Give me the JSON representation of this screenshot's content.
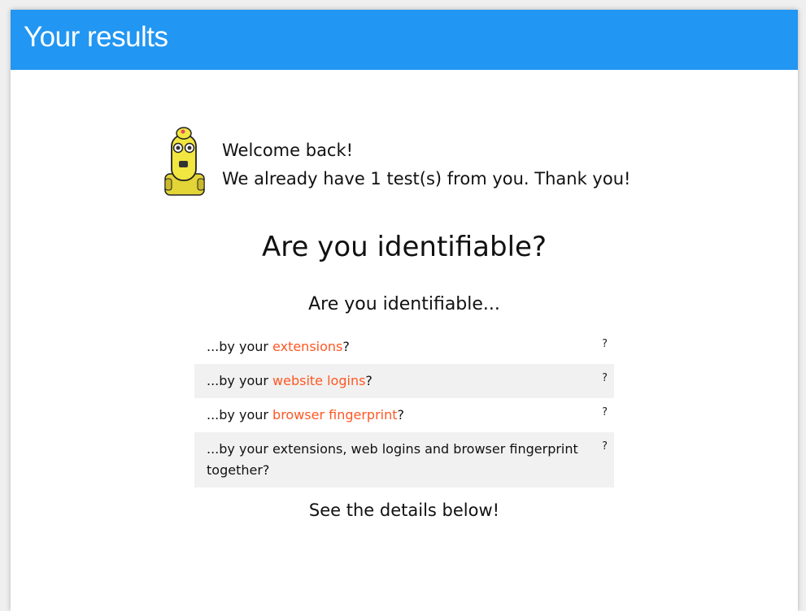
{
  "header": {
    "title": "Your results"
  },
  "welcome": {
    "greeting": "Welcome back!",
    "message": "We already have 1 test(s) from you. Thank you!"
  },
  "main": {
    "heading": "Are you identifiable?",
    "subheading": "Are you identifiable...",
    "checks": [
      {
        "prefix": "...by your ",
        "highlight": "extensions",
        "suffix": "?",
        "status": "?"
      },
      {
        "prefix": "...by your ",
        "highlight": "website logins",
        "suffix": "?",
        "status": "?"
      },
      {
        "prefix": "...by your ",
        "highlight": "browser fingerprint",
        "suffix": "?",
        "status": "?"
      },
      {
        "prefix": "...by your extensions, web logins and browser fingerprint together?",
        "highlight": "",
        "suffix": "",
        "status": "?"
      }
    ],
    "footer": "See the details below!"
  },
  "colors": {
    "header_bg": "#2196f3",
    "highlight": "#ff5722",
    "alt_row": "#f1f1f1"
  },
  "icons": {
    "mascot": "robot-mascot-icon"
  }
}
